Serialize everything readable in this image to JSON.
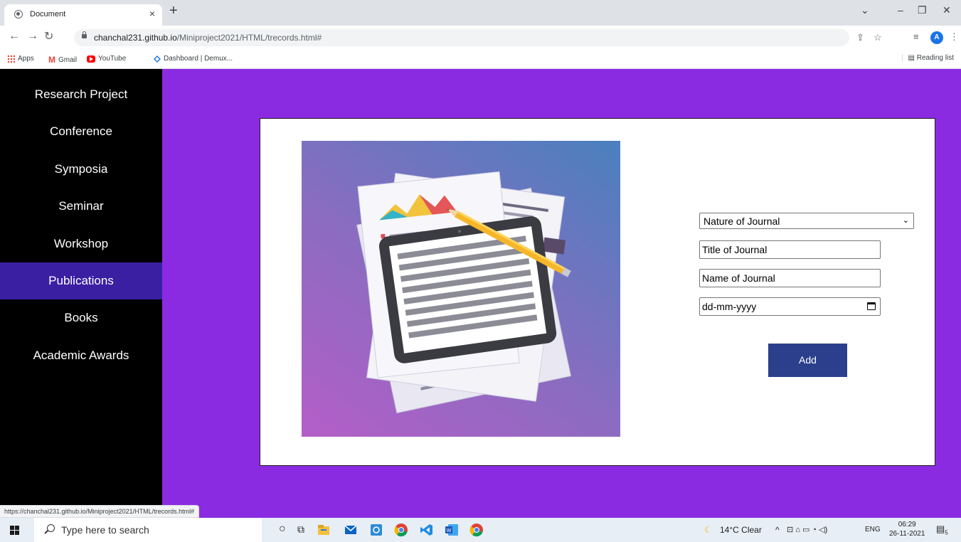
{
  "browser": {
    "tab_title": "Document",
    "url_domain": "chanchal231.github.io",
    "url_path": "/Miniproject2021/HTML/trecords.html#",
    "bookmarks": [
      "Apps",
      "Gmail",
      "YouTube",
      "Dashboard | Demux..."
    ],
    "reading_list": "Reading list",
    "profile_initial": "A",
    "status_url": "https://chanchal231.github.io/Miniproject2021/HTML/trecords.html#"
  },
  "sidebar": {
    "items": [
      {
        "label": "Research Project",
        "active": false
      },
      {
        "label": "Conference",
        "active": false
      },
      {
        "label": "Symposia",
        "active": false
      },
      {
        "label": "Seminar",
        "active": false
      },
      {
        "label": "Workshop",
        "active": false
      },
      {
        "label": "Publications",
        "active": true
      },
      {
        "label": "Books",
        "active": false
      },
      {
        "label": "Academic Awards",
        "active": false
      }
    ]
  },
  "form": {
    "nature_select": "Nature of Journal",
    "title_placeholder": "Title of Journal",
    "name_placeholder": "Name of Journal",
    "date_placeholder": "dd-mm-yyyy",
    "add_label": "Add"
  },
  "taskbar": {
    "search_placeholder": "Type here to search",
    "weather": "14°C  Clear",
    "language": "ENG",
    "time": "06:29",
    "date": "26-11-2021",
    "notifications": "5"
  },
  "colors": {
    "page_bg": "#8a2be2",
    "sidebar_bg": "#000000",
    "active_item": "#3a1fa3",
    "button_bg": "#2b3f8c"
  }
}
